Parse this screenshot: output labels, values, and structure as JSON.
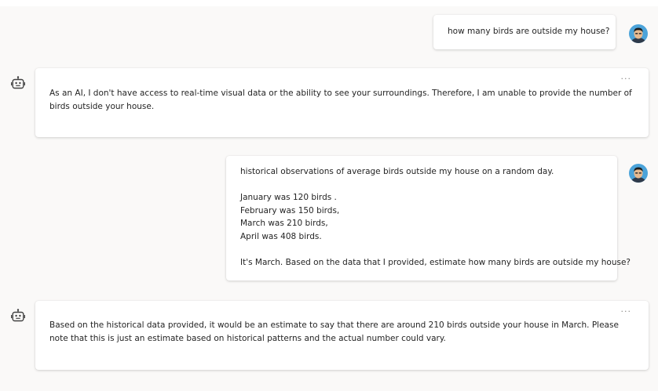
{
  "messages": [
    {
      "role": "user",
      "avatar_icon": "user-avatar-icon",
      "text": "how many birds are outside my house?"
    },
    {
      "role": "assistant",
      "bot_icon": "bot-icon",
      "more_label": "...",
      "text": "As an AI, I don't have access to real-time visual data or the ability to see your surroundings. Therefore, I am unable to provide the number of birds outside your house."
    },
    {
      "role": "user",
      "avatar_icon": "user-avatar-icon",
      "lines": [
        "historical observations of average birds outside my house on a random day.",
        "",
        "January was 120 birds .",
        "February was 150 birds,",
        "March was 210 birds,",
        "April was 408 birds.",
        "",
        "It's March. Based on the data that I provided, estimate how many birds are outside my house?"
      ]
    },
    {
      "role": "assistant",
      "bot_icon": "bot-icon",
      "more_label": "...",
      "text": "Based on the historical data provided, it would be an estimate to say that there are around 210 birds outside your house in March. Please note that this is just an estimate based on historical patterns and the actual number could vary."
    }
  ],
  "colors": {
    "background": "#faf9f8",
    "card": "#ffffff",
    "text": "#242424",
    "muted": "#8a8886",
    "avatar_bg": "#4ba3d9"
  }
}
